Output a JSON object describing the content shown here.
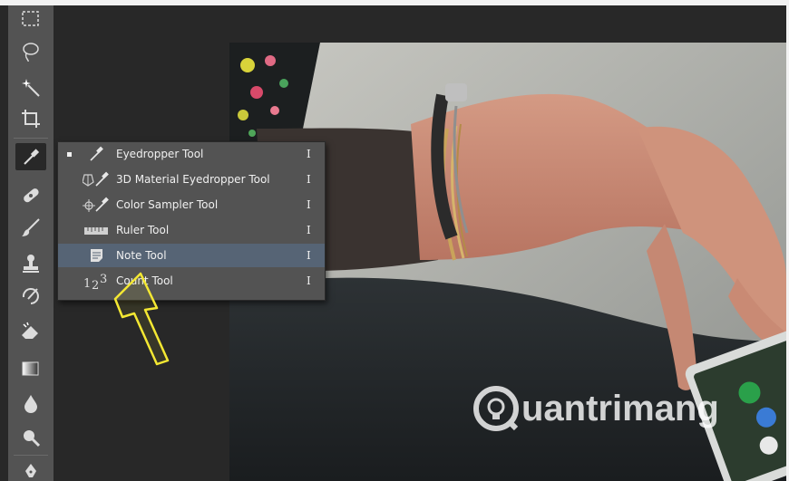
{
  "toolbar": {
    "tools": [
      {
        "name": "rectangular-marquee-tool"
      },
      {
        "name": "lasso-tool"
      },
      {
        "name": "magic-wand-tool"
      },
      {
        "name": "crop-tool"
      },
      {
        "name": "eyedropper-tool",
        "active": true
      },
      {
        "name": "spot-healing-brush-tool"
      },
      {
        "name": "brush-tool"
      },
      {
        "name": "clone-stamp-tool"
      },
      {
        "name": "history-brush-tool"
      },
      {
        "name": "eraser-tool"
      },
      {
        "name": "gradient-tool"
      },
      {
        "name": "blur-tool"
      },
      {
        "name": "dodge-tool"
      },
      {
        "name": "pen-tool"
      }
    ]
  },
  "flyout": {
    "items": [
      {
        "label": "Eyedropper Tool",
        "shortcut": "I",
        "icon": "eyedropper-icon",
        "selected": true
      },
      {
        "label": "3D Material Eyedropper Tool",
        "shortcut": "I",
        "icon": "3d-material-eyedropper-icon"
      },
      {
        "label": "Color Sampler Tool",
        "shortcut": "I",
        "icon": "color-sampler-icon"
      },
      {
        "label": "Ruler Tool",
        "shortcut": "I",
        "icon": "ruler-icon"
      },
      {
        "label": "Note Tool",
        "shortcut": "I",
        "icon": "note-icon",
        "highlighted": true
      },
      {
        "label": "Count Tool",
        "shortcut": "I",
        "icon": "count-icon"
      }
    ]
  },
  "watermark": {
    "text": "uantrimang"
  },
  "colors": {
    "toolbar": "#535353",
    "menu": "#535353",
    "highlight": "#566475",
    "canvas": "#282828",
    "arrow": "#f4e833"
  }
}
